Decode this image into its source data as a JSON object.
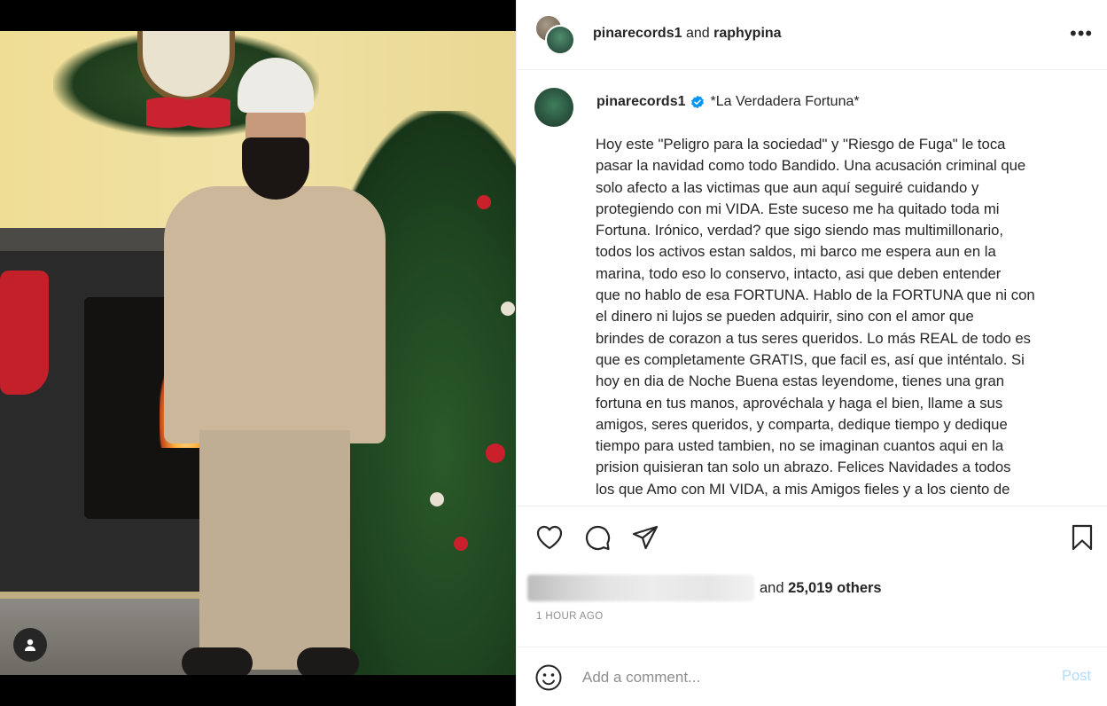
{
  "header": {
    "user1": "pinarecords1",
    "joiner": "and",
    "user2": "raphypina",
    "more": "•••"
  },
  "caption": {
    "username": "pinarecords1",
    "title": "*La Verdadera Fortuna*",
    "body": "Hoy este \"Peligro para la sociedad\" y \"Riesgo de Fuga\" le toca\npasar la navidad como todo Bandido. Una acusación criminal que\nsolo afecto a las victimas que aun aquí seguiré cuidando y\nprotegiendo con mi VIDA. Este suceso me ha quitado toda mi\nFortuna. Irónico, verdad? que sigo siendo mas multimillonario,\ntodos los activos estan saldos, mi barco me espera aun en la\nmarina, todo eso lo conservo, intacto, asi que deben entender\nque no hablo de esa FORTUNA. Hablo de la FORTUNA que ni con\nel dinero ni lujos se pueden adquirir, sino con el amor que\nbrindes de corazon a tus seres queridos. Lo más REAL de todo es\nque es completamente GRATIS, que facil es, así que inténtalo. Si\nhoy en dia de Noche Buena estas leyendome, tienes una gran\nfortuna en tus manos, aprovéchala y haga el bien, llame a sus\namigos, seres queridos, y comparta, dedique tiempo y dedique\ntiempo para usted tambien, no se imaginan cuantos aqui en la\nprision quisieran tan solo un abrazo. Felices Navidades a todos\nlos que Amo con MI VIDA, a mis Amigos fieles y a los ciento de"
  },
  "likes": {
    "prefix": "and",
    "count": "25,019 others"
  },
  "timestamp": "1 HOUR AGO",
  "comment": {
    "placeholder": "Add a comment...",
    "post_label": "Post"
  },
  "icons": [
    "heart-icon",
    "comment-icon",
    "share-icon",
    "bookmark-icon",
    "emoji-icon",
    "user-tag-icon",
    "verified-badge-icon"
  ],
  "colors": {
    "verified": "#0095f6",
    "post_button_disabled": "#b3dbff",
    "secondary_text": "#8e8e8e"
  }
}
